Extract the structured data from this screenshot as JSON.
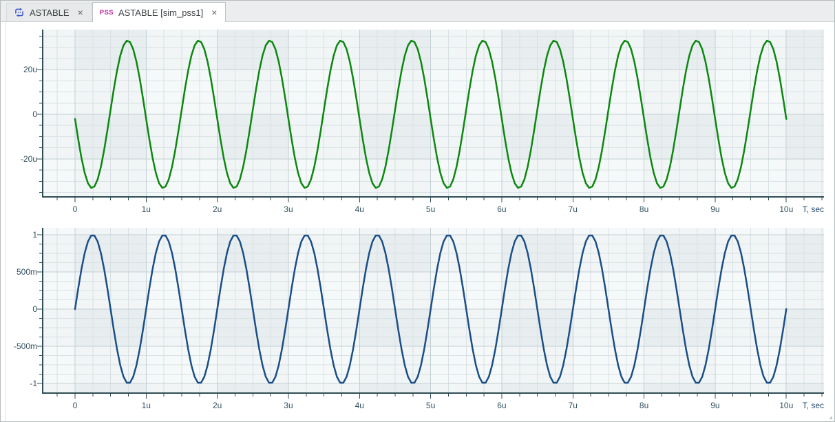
{
  "tab_bar": {
    "tabs": [
      {
        "label": "ASTABLE",
        "icon": "schematic-icon",
        "close_label": "×",
        "active": false
      },
      {
        "label": "ASTABLE [sim_pss1]",
        "badge": "PSS",
        "close_label": "×",
        "active": true
      }
    ]
  },
  "colors": {
    "trace_top": "#0c870f",
    "trace_bottom": "#1b4e86",
    "axis": "#2f4d55",
    "tick_label": "#31505e",
    "axis_unit_label": "#1d4468",
    "plot_bg": "#e8eef0",
    "plot_band_overlay": "rgba(255,255,255,0.4)",
    "grid_minor": "#d8e1e4",
    "grid_major": "#c3cfd4",
    "pss_badge": "#c0229c",
    "tab_icon": "#3d56cc"
  },
  "chart_data": [
    {
      "type": "line",
      "xlabel": "T, sec",
      "xlim": [
        -0.445,
        10.53
      ],
      "ylim": [
        -36.62,
        37.85
      ],
      "x_major_step": 1,
      "x_minor_step": 0.25,
      "y_major_step": 20,
      "y_minor_step": 5,
      "x_ticks": [
        {
          "v": 0,
          "label": "0"
        },
        {
          "v": 1,
          "label": "1u"
        },
        {
          "v": 2,
          "label": "2u"
        },
        {
          "v": 3,
          "label": "3u"
        },
        {
          "v": 4,
          "label": "4u"
        },
        {
          "v": 5,
          "label": "5u"
        },
        {
          "v": 6,
          "label": "6u"
        },
        {
          "v": 7,
          "label": "7u"
        },
        {
          "v": 8,
          "label": "8u"
        },
        {
          "v": 9,
          "label": "9u"
        },
        {
          "v": 10,
          "label": "10u"
        }
      ],
      "y_ticks": [
        {
          "v": 20,
          "label": "20u"
        },
        {
          "v": 0,
          "label": "0"
        },
        {
          "v": -20,
          "label": "-20u"
        }
      ],
      "series": [
        {
          "waveform": "sine",
          "amplitude_axis_units": 33,
          "period_axis_units": 1,
          "phase_cycles": 0.51,
          "samples_per_cycle": 22,
          "t_start": 0,
          "t_end": 10,
          "cycles_shown": 10,
          "color": "#0c870f"
        }
      ]
    },
    {
      "type": "line",
      "xlabel": "T, sec",
      "xlim": [
        -0.445,
        10.53
      ],
      "ylim": [
        -1.12,
        1.093
      ],
      "x_major_step": 1,
      "x_minor_step": 0.25,
      "y_major_step": 0.5,
      "y_minor_step": 0.125,
      "x_ticks": [
        {
          "v": 0,
          "label": "0"
        },
        {
          "v": 1,
          "label": "1u"
        },
        {
          "v": 2,
          "label": "2u"
        },
        {
          "v": 3,
          "label": "3u"
        },
        {
          "v": 4,
          "label": "4u"
        },
        {
          "v": 5,
          "label": "5u"
        },
        {
          "v": 6,
          "label": "6u"
        },
        {
          "v": 7,
          "label": "7u"
        },
        {
          "v": 8,
          "label": "8u"
        },
        {
          "v": 9,
          "label": "9u"
        },
        {
          "v": 10,
          "label": "10u"
        }
      ],
      "y_ticks": [
        {
          "v": 1,
          "label": "1"
        },
        {
          "v": 0.5,
          "label": "500m"
        },
        {
          "v": 0,
          "label": "0"
        },
        {
          "v": -0.5,
          "label": "-500m"
        },
        {
          "v": -1,
          "label": "-1"
        }
      ],
      "series": [
        {
          "waveform": "sine",
          "amplitude_axis_units": 1,
          "period_axis_units": 1,
          "phase_cycles": 0,
          "samples_per_cycle": 22,
          "t_start": 0,
          "t_end": 10,
          "cycles_shown": 10,
          "color": "#1b4e86"
        }
      ]
    }
  ]
}
